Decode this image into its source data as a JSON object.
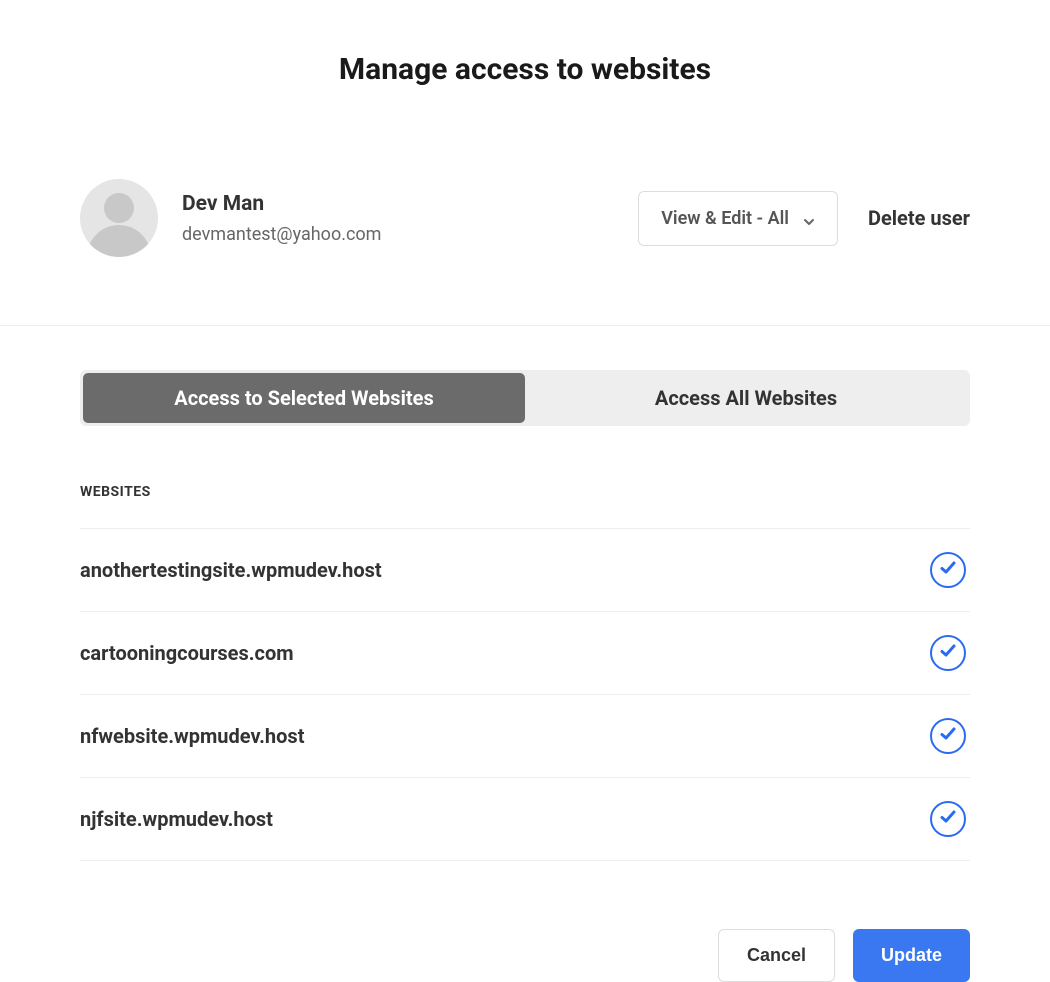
{
  "page": {
    "title": "Manage access to websites"
  },
  "user": {
    "name": "Dev Man",
    "email": "devmantest@yahoo.com",
    "dropdown_label": "View & Edit - All",
    "delete_label": "Delete user"
  },
  "tabs": {
    "selected": "Access to Selected Websites",
    "all": "Access All Websites"
  },
  "table": {
    "header": "WEBSITES",
    "rows": [
      {
        "label": "anothertestingsite.wpmudev.host",
        "checked": true
      },
      {
        "label": "cartooningcourses.com",
        "checked": true
      },
      {
        "label": "nfwebsite.wpmudev.host",
        "checked": true
      },
      {
        "label": "njfsite.wpmudev.host",
        "checked": true
      }
    ]
  },
  "footer": {
    "cancel": "Cancel",
    "update": "Update"
  }
}
